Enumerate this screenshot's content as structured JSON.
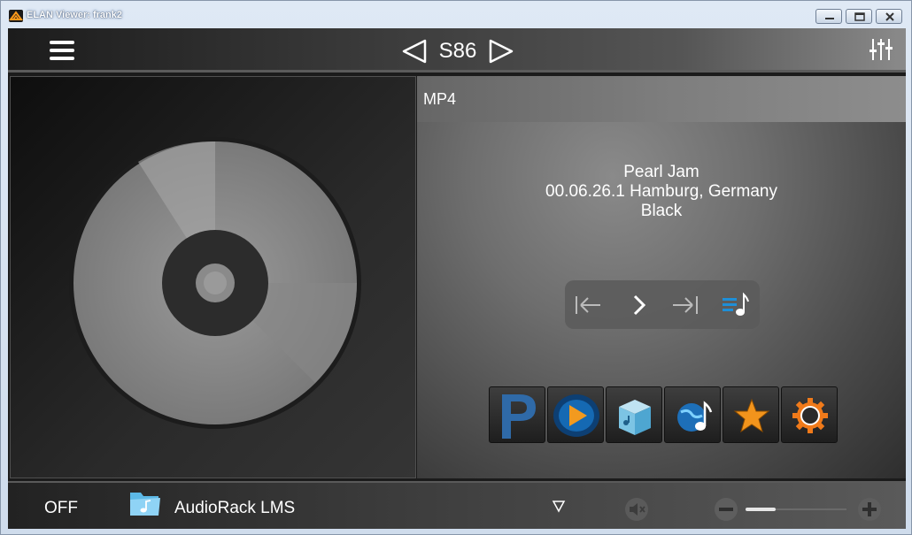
{
  "window": {
    "title": "ELAN Viewer: frank2"
  },
  "header": {
    "zone_name": "S86",
    "menu_icon": "hamburger-menu-icon",
    "prev_icon": "triangle-left-icon",
    "next_icon": "triangle-right-icon",
    "settings_icon": "mixer-sliders-icon"
  },
  "player": {
    "source": "MP4",
    "track": {
      "artist": "Pearl Jam",
      "album": "00.06.26.1 Hamburg, Germany",
      "title": "Black"
    },
    "transport": [
      {
        "name": "previous-track-icon"
      },
      {
        "name": "play-icon"
      },
      {
        "name": "next-track-icon"
      },
      {
        "name": "queue-icon"
      }
    ],
    "sources": [
      {
        "name": "pandora-icon"
      },
      {
        "name": "media-player-icon"
      },
      {
        "name": "music-box-icon"
      },
      {
        "name": "internet-radio-icon"
      },
      {
        "name": "favorites-star-icon"
      },
      {
        "name": "settings-gear-icon"
      }
    ]
  },
  "footer": {
    "power": "OFF",
    "device": "AudioRack LMS",
    "volume_fraction": 0.3
  },
  "colors": {
    "accent_blue": "#1e8fd8",
    "text": "#ffffff"
  }
}
